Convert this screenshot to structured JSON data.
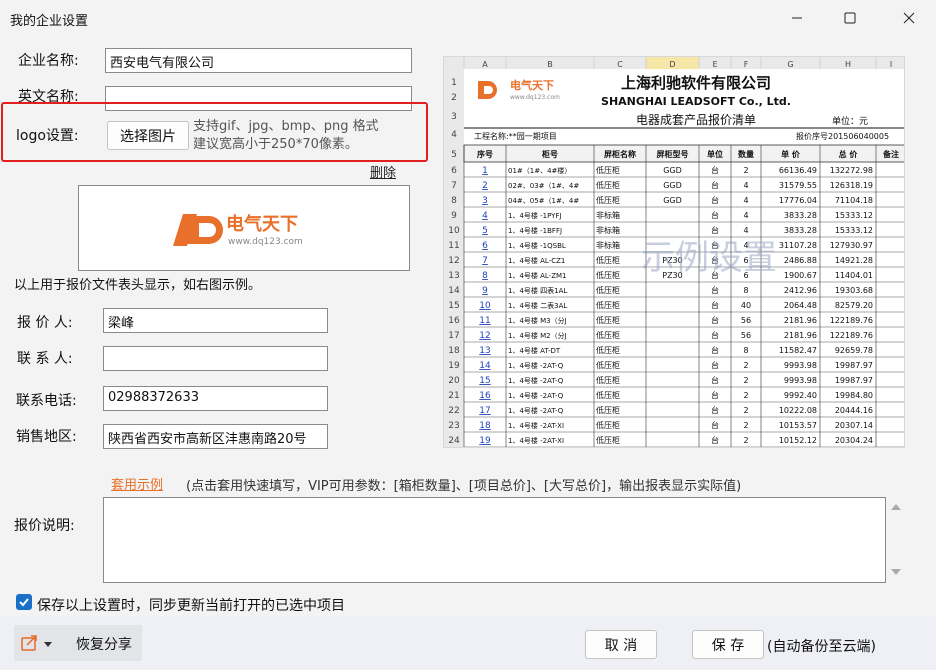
{
  "window": {
    "title": "我的企业设置"
  },
  "form": {
    "company_name_label": "企业名称:",
    "company_name_value": "西安电气有限公司",
    "english_name_label": "英文名称:",
    "english_name_value": "",
    "logo_label": "logo设置:",
    "choose_image_button": "选择图片",
    "logo_hint_line1": "支持gif、jpg、bmp、png 格式",
    "logo_hint_line2": "建议宽高小于250*70像素。",
    "delete_link": "删除",
    "logo_note": "以上用于报价文件表头显示，如右图示例。",
    "quoter_label": "报 价 人:",
    "quoter_value": "梁峰",
    "contact_label": "联 系 人:",
    "contact_value": "",
    "phone_label": "联系电话:",
    "phone_value": "02988372633",
    "region_label": "销售地区:",
    "region_value": "陕西省西安市高新区沣惠南路20号",
    "apply_example_link": "套用示例",
    "apply_example_hint": "(点击套用快速填写，VIP可用参数：[箱柜数量]、[项目总价]、[大写总价]，输出报表显示实际值)",
    "quote_desc_label": "报价说明:",
    "quote_desc_value": ""
  },
  "logo": {
    "brand": "电气天下",
    "url": "www.dq123.com",
    "brand_color": "#e8702a"
  },
  "sheet": {
    "columns": [
      "A",
      "B",
      "C",
      "D",
      "E",
      "F",
      "G",
      "H",
      "I"
    ],
    "company_cn": "上海利驰软件有限公司",
    "company_en": "SHANGHAI LEADSOFT Co., Ltd.",
    "doc_title": "电器成套产品报价清单",
    "unit_note": "单位：元",
    "project_label": "工程名称:**园一期项目",
    "quote_no": "报价序号201506040005",
    "headers": [
      "序号",
      "柜号",
      "屏柜名称",
      "屏柜型号",
      "单位",
      "数量",
      "单 价",
      "总 价",
      "备注"
    ],
    "watermark": "示例设置",
    "rows": [
      [
        "6",
        "1",
        "01#（1#、4#楼）",
        "低压柜",
        "GGD",
        "台",
        "2",
        "66136.49",
        "132272.98"
      ],
      [
        "7",
        "2",
        "02#、03#（1#、4#",
        "低压柜",
        "GGD",
        "台",
        "4",
        "31579.55",
        "126318.19"
      ],
      [
        "8",
        "3",
        "04#、05#（1#、4#",
        "低压柜",
        "GGD",
        "台",
        "4",
        "17776.04",
        "71104.18"
      ],
      [
        "9",
        "4",
        "1、4号楼 -1PYFJ",
        "非标箱",
        "",
        "台",
        "4",
        "3833.28",
        "15333.12"
      ],
      [
        "10",
        "5",
        "1、4号楼 -1BFFJ",
        "非标箱",
        "",
        "台",
        "4",
        "3833.28",
        "15333.12"
      ],
      [
        "11",
        "6",
        "1、4号楼 -1QSBL",
        "非标箱",
        "",
        "台",
        "4",
        "31107.28",
        "127930.97"
      ],
      [
        "12",
        "7",
        "1、4号楼 AL-CZ1",
        "低压柜",
        "PZ30",
        "台",
        "6",
        "2486.88",
        "14921.28"
      ],
      [
        "13",
        "8",
        "1、4号楼 AL-ZM1",
        "低压柜",
        "PZ30",
        "台",
        "6",
        "1900.67",
        "11404.01"
      ],
      [
        "14",
        "9",
        "1、4号楼 四表1AL",
        "低压柜",
        "",
        "台",
        "8",
        "2412.96",
        "19303.68"
      ],
      [
        "15",
        "10",
        "1、4号楼 二表3AL",
        "低压柜",
        "",
        "台",
        "40",
        "2064.48",
        "82579.20"
      ],
      [
        "16",
        "11",
        "1、4号楼 M3（分J",
        "低压柜",
        "",
        "台",
        "56",
        "2181.96",
        "122189.76"
      ],
      [
        "17",
        "12",
        "1、4号楼 M2（分J",
        "低压柜",
        "",
        "台",
        "56",
        "2181.96",
        "122189.76"
      ],
      [
        "18",
        "13",
        "1、4号楼 AT-DT",
        "低压柜",
        "",
        "台",
        "8",
        "11582.47",
        "92659.78"
      ],
      [
        "19",
        "14",
        "1、4号楼 -2AT-Q",
        "低压柜",
        "",
        "台",
        "2",
        "9993.98",
        "19987.97"
      ],
      [
        "20",
        "15",
        "1、4号楼 -2AT-Q",
        "低压柜",
        "",
        "台",
        "2",
        "9993.98",
        "19987.97"
      ],
      [
        "21",
        "16",
        "1、4号楼 -2AT-Q",
        "低压柜",
        "",
        "台",
        "2",
        "9992.40",
        "19984.80"
      ],
      [
        "22",
        "17",
        "1、4号楼 -2AT-Q",
        "低压柜",
        "",
        "台",
        "2",
        "10222.08",
        "20444.16"
      ],
      [
        "23",
        "18",
        "1、4号楼 -2AT-XI",
        "低压柜",
        "",
        "台",
        "2",
        "10153.57",
        "20307.14"
      ],
      [
        "24",
        "19",
        "1、4号楼 -2AT-XI",
        "低压柜",
        "",
        "台",
        "2",
        "10152.12",
        "20304.24"
      ]
    ]
  },
  "footer": {
    "sync_checkbox_label": "保存以上设置时，同步更新当前打开的已选中项目",
    "sync_checked": true,
    "restore_share_label": "恢复分享",
    "cancel_button": "取 消",
    "save_button": "保 存",
    "auto_backup_note": "(自动备份至云端)"
  }
}
